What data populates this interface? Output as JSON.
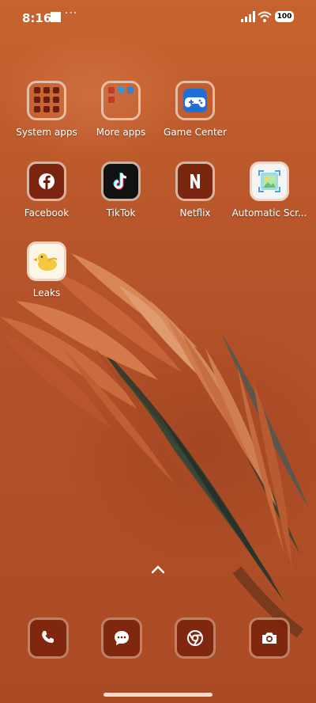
{
  "status_bar": {
    "time": "8:16",
    "battery": "100",
    "icons": [
      "notification-square-icon",
      "more-dots-icon",
      "signal-icon",
      "wifi-icon",
      "battery-icon"
    ]
  },
  "apps": [
    {
      "label": "System apps",
      "icon": "folder-icon"
    },
    {
      "label": "More apps",
      "icon": "folder-icon"
    },
    {
      "label": "Game Center",
      "icon": "gamepad-icon"
    },
    {
      "label": "Facebook",
      "icon": "facebook-icon"
    },
    {
      "label": "TikTok",
      "icon": "tiktok-icon"
    },
    {
      "label": "Netflix",
      "icon": "netflix-icon"
    },
    {
      "label": "Automatic Scr...",
      "icon": "screenshot-icon"
    },
    {
      "label": "Leaks",
      "icon": "duck-icon"
    }
  ],
  "dock": [
    {
      "name": "phone",
      "icon": "phone-icon"
    },
    {
      "name": "messages",
      "icon": "message-icon"
    },
    {
      "name": "chrome",
      "icon": "chrome-icon"
    },
    {
      "name": "camera",
      "icon": "camera-icon"
    }
  ],
  "colors": {
    "wallpaper": "#b8532a",
    "icon_border": "#ebcdb9",
    "dock_bg": "#78220c"
  }
}
